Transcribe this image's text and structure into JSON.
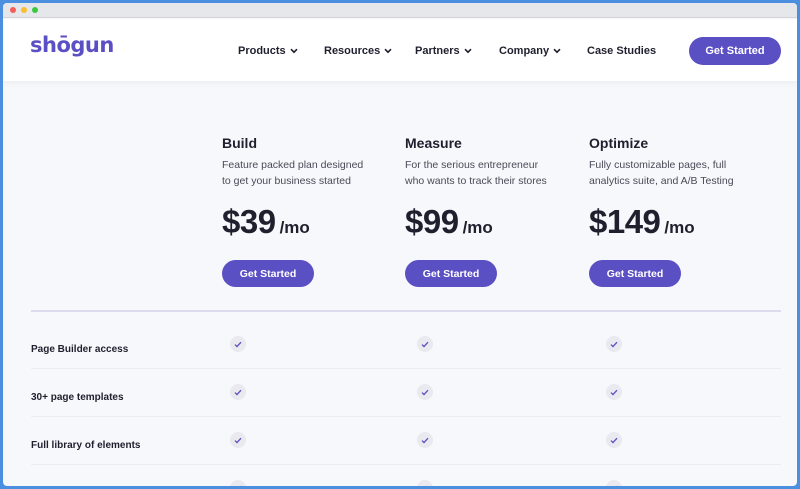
{
  "window": {
    "controls": [
      "close",
      "minimize",
      "maximize"
    ]
  },
  "navbar": {
    "logo": "shōgun",
    "items": [
      {
        "label": "Products",
        "has_dropdown": true
      },
      {
        "label": "Resources",
        "has_dropdown": true
      },
      {
        "label": "Partners",
        "has_dropdown": true
      },
      {
        "label": "Company",
        "has_dropdown": true
      },
      {
        "label": "Case Studies",
        "has_dropdown": false
      }
    ],
    "cta_label": "Get Started"
  },
  "plans": [
    {
      "name": "Build",
      "description_line1": "Feature packed plan designed",
      "description_line2": "to get your business started",
      "price": "$39",
      "period": "/mo",
      "cta_label": "Get Started"
    },
    {
      "name": "Measure",
      "description_line1": "For the serious entrepreneur",
      "description_line2": "who wants to track their stores",
      "price": "$99",
      "period": "/mo",
      "cta_label": "Get Started"
    },
    {
      "name": "Optimize",
      "description_line1": "Fully customizable pages, full",
      "description_line2": "analytics suite, and A/B Testing",
      "price": "$149",
      "period": "/mo",
      "cta_label": "Get Started"
    }
  ],
  "features": [
    {
      "label": "Page Builder access",
      "included": [
        true,
        true,
        true
      ]
    },
    {
      "label": "30+ page templates",
      "included": [
        true,
        true,
        true
      ]
    },
    {
      "label": "Full library of elements",
      "included": [
        true,
        true,
        true
      ]
    }
  ],
  "colors": {
    "brand": "#5b4fc4",
    "text": "#1f1f2e",
    "muted_text": "#4a4a58",
    "check_bg": "#e9e9ef",
    "frame": "#4a8fe0"
  },
  "icons": {
    "nav_dropdown": "chevron-down-icon",
    "feature_included": "check-icon"
  }
}
